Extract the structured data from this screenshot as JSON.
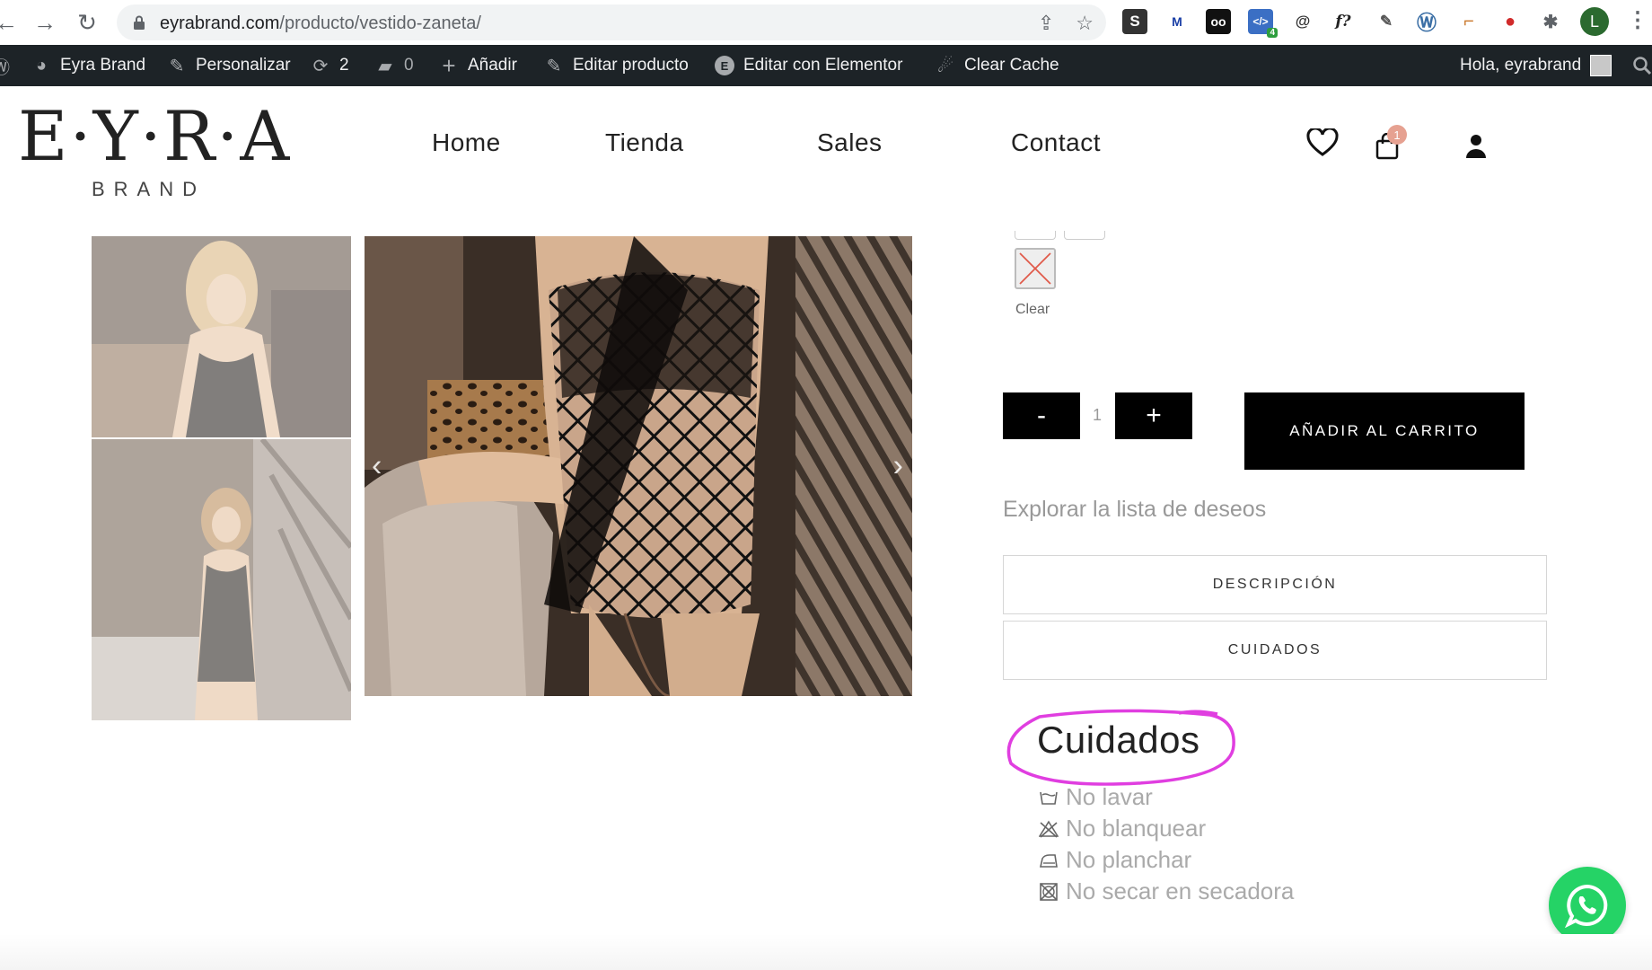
{
  "browser": {
    "url_domain": "eyrabrand.com",
    "url_path": "/producto/vestido-zaneta/",
    "extensions": [
      "S",
      "M",
      "oo",
      "</>",
      "@",
      "f?"
    ],
    "extension_badge": "4",
    "profile_initial": "L"
  },
  "admin_bar": {
    "site_name": "Eyra Brand",
    "customize": "Personalizar",
    "updates_count": "2",
    "comments_count": "0",
    "add_new": "Añadir",
    "edit_product": "Editar producto",
    "elementor": "Editar con Elementor",
    "clear_cache": "Clear Cache",
    "greeting": "Hola, eyrabrand"
  },
  "header": {
    "logo_main": "E·Y·R·A",
    "logo_sub": "BRAND",
    "nav": [
      "Home",
      "Tienda",
      "Sales",
      "Contact"
    ],
    "cart_count": "1"
  },
  "product": {
    "clear_label": "Clear",
    "qty_minus": "-",
    "qty_value": "1",
    "qty_plus": "+",
    "add_to_cart": "AÑADIR AL CARRITO",
    "wishlist_link": "Explorar la lista de deseos",
    "accordion": [
      "DESCRIPCIÓN",
      "CUIDADOS"
    ]
  },
  "care": {
    "title": "Cuidados",
    "items": [
      "No lavar",
      "No blanquear",
      "No planchar",
      "No secar en secadora"
    ]
  },
  "colors": {
    "admin_bar": "#1d2327",
    "accent_highlight": "#e03ee0",
    "cart_badge": "#e6a191",
    "whatsapp": "#25d366"
  }
}
